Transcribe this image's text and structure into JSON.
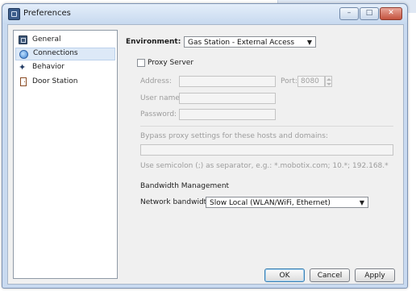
{
  "window": {
    "title": "Preferences",
    "minimize_glyph": "–",
    "maximize_glyph": "□",
    "close_glyph": "✕"
  },
  "nav": {
    "items": [
      {
        "label": "General",
        "icon": "general-icon"
      },
      {
        "label": "Connections",
        "icon": "globe-icon",
        "selected": true
      },
      {
        "label": "Behavior",
        "icon": "behavior-icon"
      },
      {
        "label": "Door Station",
        "icon": "door-icon"
      }
    ]
  },
  "environment": {
    "label": "Environment:",
    "value": "Gas Station - External Access"
  },
  "proxy": {
    "label": "Proxy Server",
    "checked": false,
    "address_label": "Address:",
    "address_value": "",
    "port_label": "Port:",
    "port_value": "8080",
    "username_label": "User name:",
    "username_value": "",
    "password_label": "Password:",
    "password_value": "",
    "bypass_label": "Bypass proxy settings for these hosts and domains:",
    "bypass_value": "",
    "hint": "Use semicolon (;) as separator, e.g.: *.mobotix.com; 10.*; 192.168.*"
  },
  "bandwidth": {
    "section_title": "Bandwidth Management",
    "label": "Network bandwidth:",
    "value": "Slow Local (WLAN/WiFi, Ethernet)"
  },
  "buttons": {
    "ok": "OK",
    "cancel": "Cancel",
    "apply": "Apply"
  },
  "icons": {
    "dropdown": "▼"
  },
  "colors": {
    "title_bar": "#c7d9ef",
    "selection": "#dde9f7",
    "disabled_text": "#9c9c9c"
  }
}
